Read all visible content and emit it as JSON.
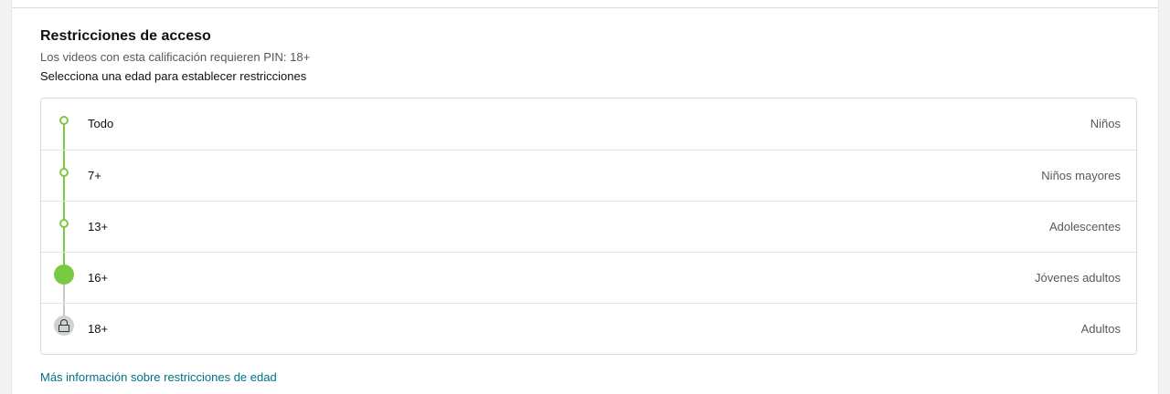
{
  "section": {
    "title": "Restricciones de acceso",
    "subtitle": "Los videos con esta calificación requieren PIN: 18+",
    "instruction": "Selecciona una edad para establecer restricciones"
  },
  "ratings": [
    {
      "label": "Todo",
      "description": "Niños",
      "state": "allowed"
    },
    {
      "label": "7+",
      "description": "Niños mayores",
      "state": "allowed"
    },
    {
      "label": "13+",
      "description": "Adolescentes",
      "state": "allowed"
    },
    {
      "label": "16+",
      "description": "Jóvenes adultos",
      "state": "selected"
    },
    {
      "label": "18+",
      "description": "Adultos",
      "state": "locked"
    }
  ],
  "links": {
    "more_info": "Más información sobre restricciones de edad"
  },
  "colors": {
    "accent_green": "#7ac943",
    "link": "#007185",
    "locked_grey": "#cfd2d2"
  },
  "icons": {
    "allowed": "ring-node-icon",
    "selected": "selected-node-icon",
    "locked": "lock-icon"
  }
}
